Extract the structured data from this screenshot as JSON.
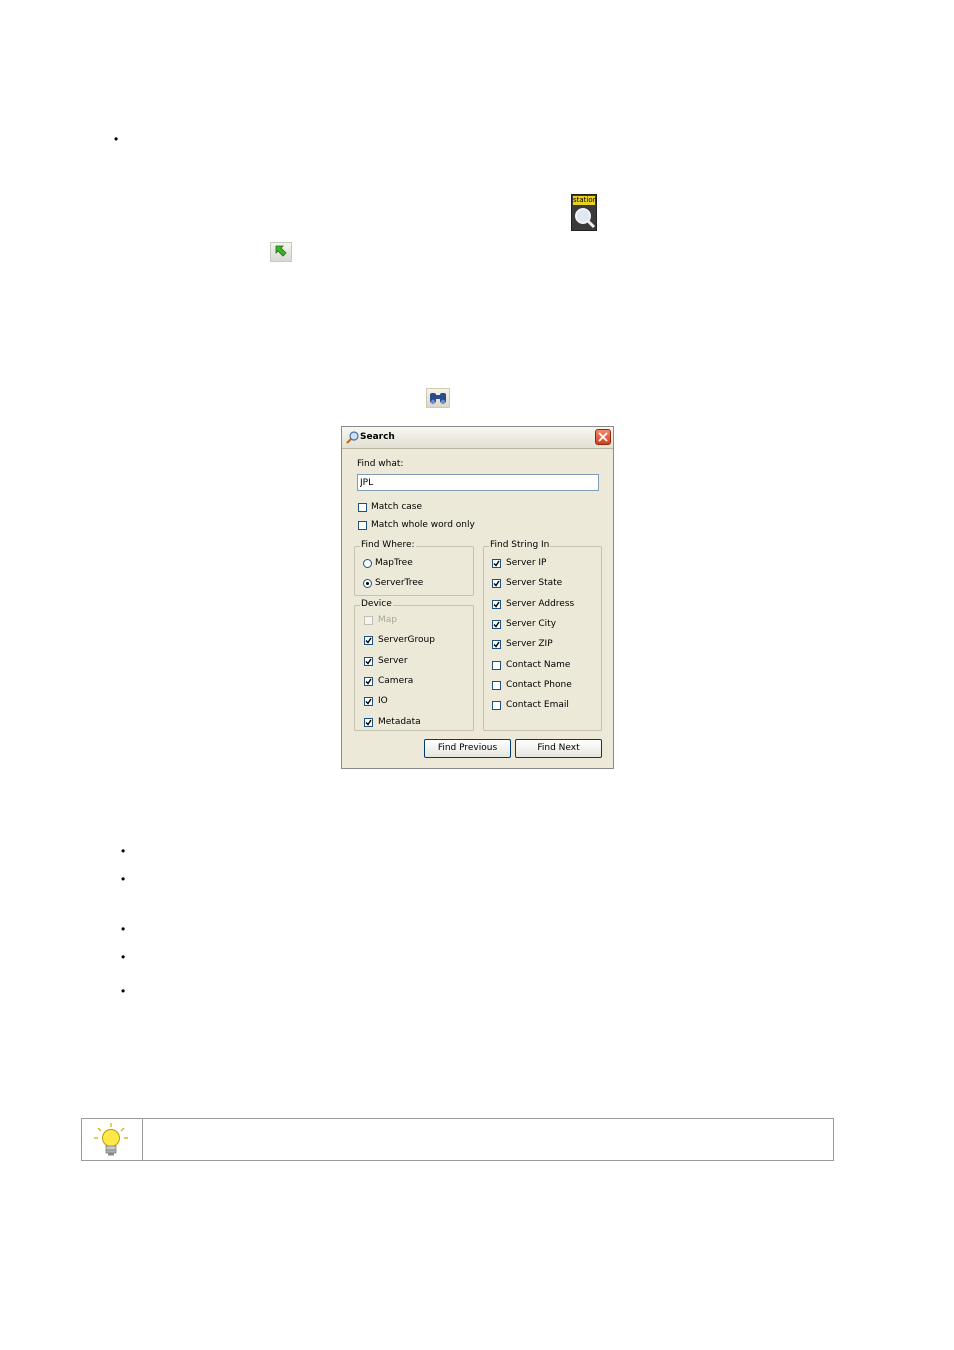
{
  "doc": {
    "bullet_glyph": "•",
    "station_icon_label": "station"
  },
  "dialog": {
    "title": "Search",
    "find_what_label": "Find what:",
    "find_what_value": "JPL",
    "match_case_label": "Match case",
    "match_whole_word_label": "Match whole word only",
    "find_where": {
      "title": "Find Where:",
      "options": [
        {
          "label": "MapTree",
          "selected": false
        },
        {
          "label": "ServerTree",
          "selected": true
        }
      ]
    },
    "device": {
      "title": "Device",
      "items": [
        {
          "label": "Map",
          "checked": false,
          "disabled": true
        },
        {
          "label": "ServerGroup",
          "checked": true,
          "disabled": false
        },
        {
          "label": "Server",
          "checked": true,
          "disabled": false
        },
        {
          "label": "Camera",
          "checked": true,
          "disabled": false
        },
        {
          "label": "IO",
          "checked": true,
          "disabled": false
        },
        {
          "label": "Metadata",
          "checked": true,
          "disabled": false
        }
      ]
    },
    "find_string_in": {
      "title": "Find String In",
      "items": [
        {
          "label": "Server IP",
          "checked": true
        },
        {
          "label": "Server State",
          "checked": true
        },
        {
          "label": "Server Address",
          "checked": true
        },
        {
          "label": "Server City",
          "checked": true
        },
        {
          "label": "Server ZIP",
          "checked": true
        },
        {
          "label": "Contact Name",
          "checked": false
        },
        {
          "label": "Contact Phone",
          "checked": false
        },
        {
          "label": "Contact Email",
          "checked": false
        }
      ]
    },
    "find_previous_label": "Find Previous",
    "find_next_label": "Find Next"
  }
}
